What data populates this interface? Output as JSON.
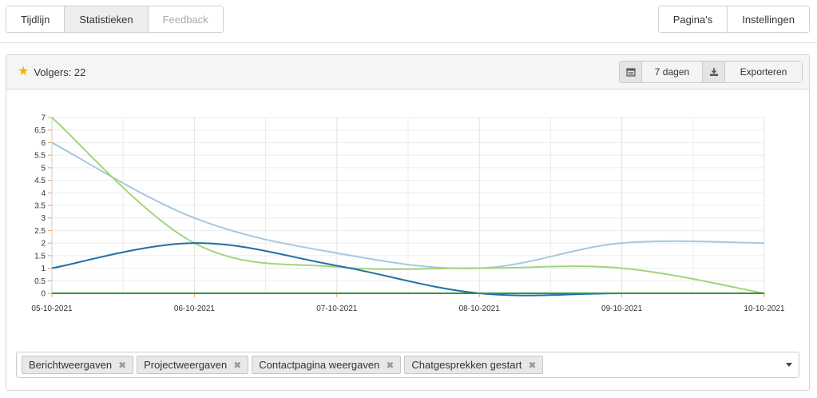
{
  "nav": {
    "left_tabs": [
      {
        "label": "Tijdlijn",
        "state": "normal"
      },
      {
        "label": "Statistieken",
        "state": "active"
      },
      {
        "label": "Feedback",
        "state": "disabled"
      }
    ],
    "right_tabs": [
      {
        "label": "Pagina's"
      },
      {
        "label": "Instellingen"
      }
    ]
  },
  "panel": {
    "followers_label": "Volgers: 22",
    "range_label": "7 dagen",
    "export_label": "Exporteren",
    "icons": {
      "followers": "star-icon",
      "range": "calendar-icon",
      "export": "download-icon"
    },
    "star_color": "#f0b400"
  },
  "chart_data": {
    "type": "line",
    "x": [
      "05-10-2021",
      "06-10-2021",
      "07-10-2021",
      "08-10-2021",
      "09-10-2021",
      "10-10-2021"
    ],
    "ylim": [
      0,
      7
    ],
    "yticks": [
      "0",
      "0.5",
      "1",
      "1.5",
      "2",
      "2.5",
      "3",
      "3.5",
      "4",
      "4.5",
      "5",
      "5.5",
      "6",
      "6.5",
      "7"
    ],
    "grid": true,
    "series": [
      {
        "name": "Berichtweergaven",
        "color": "#a6c8de",
        "values": [
          6,
          3,
          1.6,
          1,
          2,
          2
        ]
      },
      {
        "name": "Projectweergaven",
        "color": "#a3d47c",
        "values": [
          7,
          2,
          1.05,
          1,
          1,
          0
        ]
      },
      {
        "name": "Contactpagina weergaven",
        "color": "#1f6fa8",
        "values": [
          1,
          2,
          1.1,
          0,
          0,
          0
        ]
      },
      {
        "name": "Chatgesprekken gestart",
        "color": "#2e9a33",
        "values": [
          0,
          0,
          0,
          0,
          0,
          0
        ]
      }
    ]
  },
  "filter": {
    "tags": [
      "Berichtweergaven",
      "Projectweergaven",
      "Contactpagina weergaven",
      "Chatgesprekken gestart"
    ],
    "remove_glyph": "✖"
  }
}
